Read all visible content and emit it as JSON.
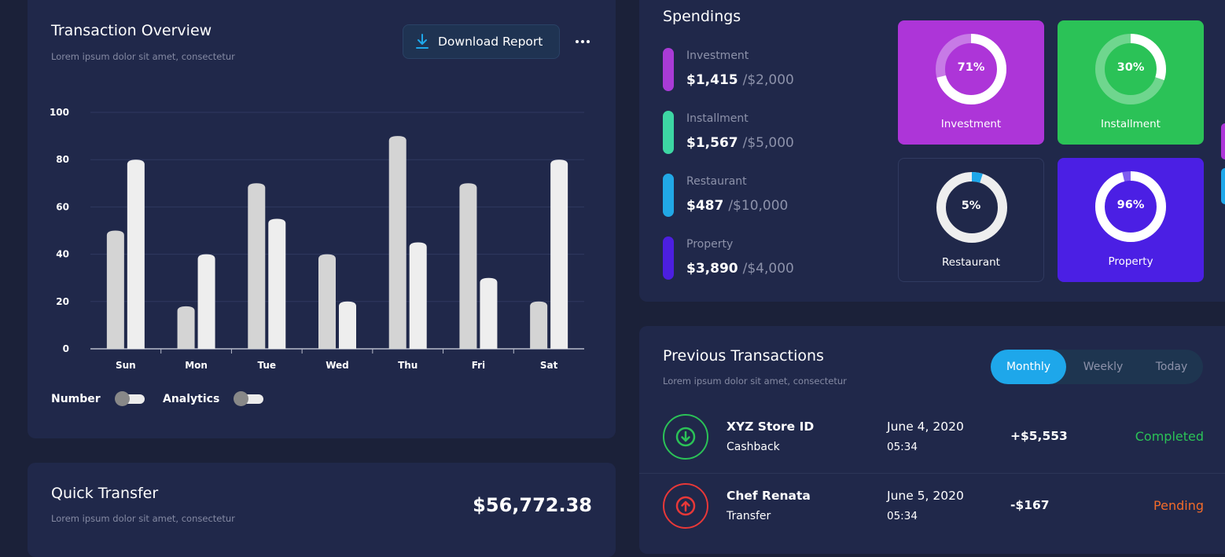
{
  "overview": {
    "title": "Transaction Overview",
    "subtitle": "Lorem ipsum dolor sit amet, consectetur",
    "download_label": "Download Report",
    "toggles": [
      {
        "label": "Number",
        "on": false
      },
      {
        "label": "Analytics",
        "on": false
      }
    ]
  },
  "chart_data": {
    "type": "bar",
    "categories": [
      "Sun",
      "Mon",
      "Tue",
      "Wed",
      "Thu",
      "Fri",
      "Sat"
    ],
    "series": [
      {
        "values": [
          50,
          18,
          70,
          40,
          90,
          70,
          20
        ],
        "color": "#d4d4d4"
      },
      {
        "values": [
          80,
          40,
          55,
          20,
          45,
          30,
          80
        ],
        "color": "#eeeeee"
      }
    ],
    "ylim": [
      0,
      100
    ],
    "yticks": [
      0,
      20,
      40,
      60,
      80,
      100
    ],
    "grid": true,
    "title": "",
    "xlabel": "",
    "ylabel": ""
  },
  "quick": {
    "title": "Quick Transfer",
    "subtitle": "Lorem ipsum dolor sit amet, consectetur",
    "amount": "$56,772.38"
  },
  "spendings": {
    "title": "Spendings",
    "items": [
      {
        "name": "Investment",
        "value": "$1,415",
        "max": "/$2,000",
        "color": "#a93bd6"
      },
      {
        "name": "Installment",
        "value": "$1,567",
        "max": "/$5,000",
        "color": "#3dd6a3"
      },
      {
        "name": "Restaurant",
        "value": "$487",
        "max": "/$10,000",
        "color": "#21a8e6"
      },
      {
        "name": "Property",
        "value": "$3,890",
        "max": "/$4,000",
        "color": "#4c1fe0"
      }
    ],
    "tiles": [
      {
        "label": "Investment",
        "percent": 71,
        "percent_text": "71%",
        "bg": "#ad35d8",
        "track": "#c77ae6",
        "fill": "#ffffff"
      },
      {
        "label": "Installment",
        "percent": 30,
        "percent_text": "30%",
        "bg": "#2bc257",
        "track": "#6fd68e",
        "fill": "#ffffff"
      },
      {
        "label": "Restaurant",
        "percent": 5,
        "percent_text": "5%",
        "bg": "#20284a",
        "track": "#eeeeee",
        "fill": "#1ea7ea"
      },
      {
        "label": "Property",
        "percent": 96,
        "percent_text": "96%",
        "bg": "#4b1fe4",
        "track": "#7f5cf0",
        "fill": "#ffffff"
      }
    ]
  },
  "transactions": {
    "title": "Previous Transactions",
    "subtitle": "Lorem ipsum dolor sit amet, consectetur",
    "tabs": [
      {
        "label": "Monthly",
        "active": true
      },
      {
        "label": "Weekly",
        "active": false
      },
      {
        "label": "Today",
        "active": false
      }
    ],
    "rows": [
      {
        "name": "XYZ Store ID",
        "type": "Cashback",
        "date": "June 4, 2020",
        "time": "05:34",
        "amount": "+$5,553",
        "status": "Completed",
        "status_color": "#2bc257",
        "icon": "arrow-down-icon",
        "icon_color": "#2bc257"
      },
      {
        "name": "Chef Renata",
        "type": "Transfer",
        "date": "June 5, 2020",
        "time": "05:34",
        "amount": "-$167",
        "status": "Pending",
        "status_color": "#f26b2a",
        "icon": "arrow-up-icon",
        "icon_color": "#e83838"
      }
    ]
  }
}
